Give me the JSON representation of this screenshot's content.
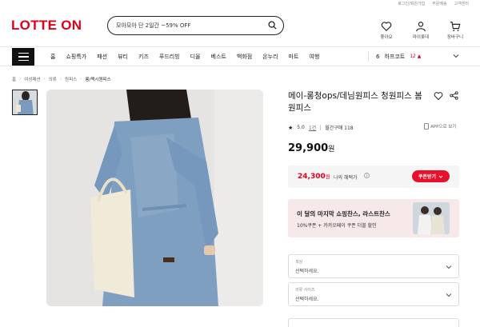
{
  "util": [
    "로그인/회원가입",
    "주문배송",
    "고객센터"
  ],
  "logo": {
    "text1": "LOTTE",
    "text2": "ON"
  },
  "search": {
    "placeholder": "모아모아 단 2일간 ~59% OFF"
  },
  "header_icons": [
    {
      "icon": "heart-icon",
      "label": "좋아요"
    },
    {
      "icon": "user-icon",
      "label": "마이롯데"
    },
    {
      "icon": "cart-icon",
      "label": "장바구니"
    }
  ],
  "nav": {
    "items": [
      "홈",
      "쇼핑특가",
      "패션",
      "뷰티",
      "키즈",
      "푸드리빙",
      "디올",
      "베스트",
      "백화점",
      "온누리",
      "마트",
      "여행"
    ],
    "rank_num": "6",
    "rank_label": "하프코트",
    "rank_count": "12 ▲"
  },
  "breadcrumb": [
    "홈",
    "여성패션",
    "의류",
    "원피스",
    "롱/맥시원피스"
  ],
  "product": {
    "title": "메이-롱청ops/데님원피스 청원피스 봄원피스",
    "rating": "5.0",
    "reviews": "1건",
    "monthly": "월간구매 118",
    "app_view": "APP으로 보기",
    "price": "29,900",
    "price_unit": "원"
  },
  "benefit": {
    "price": "24,300",
    "price_unit": "원",
    "label": "나의 혜택가",
    "coupon_btn": "쿠폰받기"
  },
  "promo": {
    "title": "이 달의 마지막 쇼핑찬스, 라스트찬스",
    "subtitle": "10%쿠폰 + 카카오페이 쿠폰 더블 할인"
  },
  "options": [
    {
      "label": "색상",
      "value": "선택하세요."
    },
    {
      "label": "의류 사이즈",
      "value": "선택하세요."
    }
  ],
  "colors": {
    "brand": "#e0001a",
    "coupon": "#e8112d",
    "promo_bg": "#f7e9ea"
  }
}
